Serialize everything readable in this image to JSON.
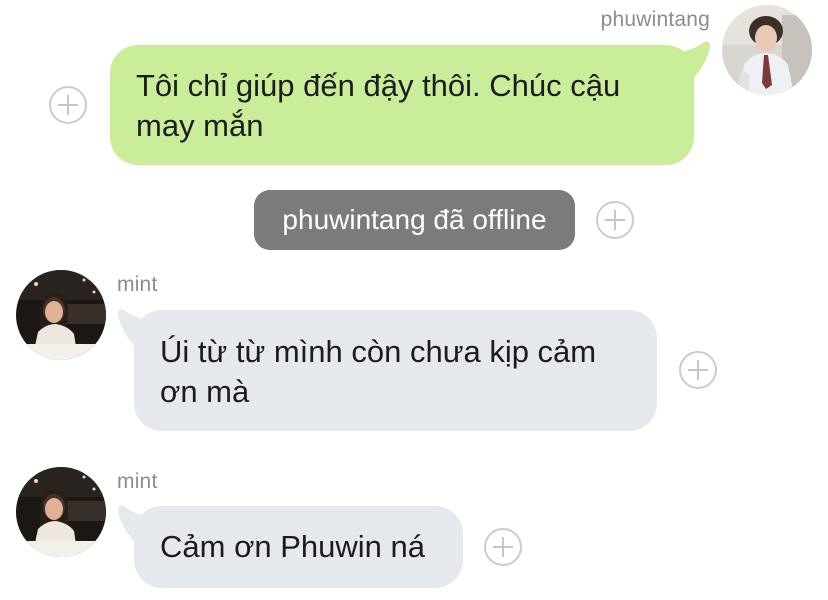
{
  "messages": [
    {
      "sender": "phuwintang",
      "direction": "outgoing",
      "lines": [
        "Tôi chỉ giúp đến đậy thôi. Chúc cậu",
        "may mắn"
      ]
    },
    {
      "type": "system",
      "text": "phuwintang đã offline"
    },
    {
      "sender": "mint",
      "direction": "incoming",
      "lines": [
        "Úi từ từ mình còn chưa kịp cảm",
        "ơn mà"
      ]
    },
    {
      "sender": "mint",
      "direction": "incoming",
      "lines": [
        "Cảm ơn Phuwin ná"
      ]
    }
  ],
  "colors": {
    "outgoing_bubble": "#c9ed99",
    "incoming_bubble": "#e5e8ec",
    "system_bubble": "#7b7b7b",
    "name_text": "#8a8d91"
  },
  "icons": {
    "add": "plus-circle-icon"
  }
}
